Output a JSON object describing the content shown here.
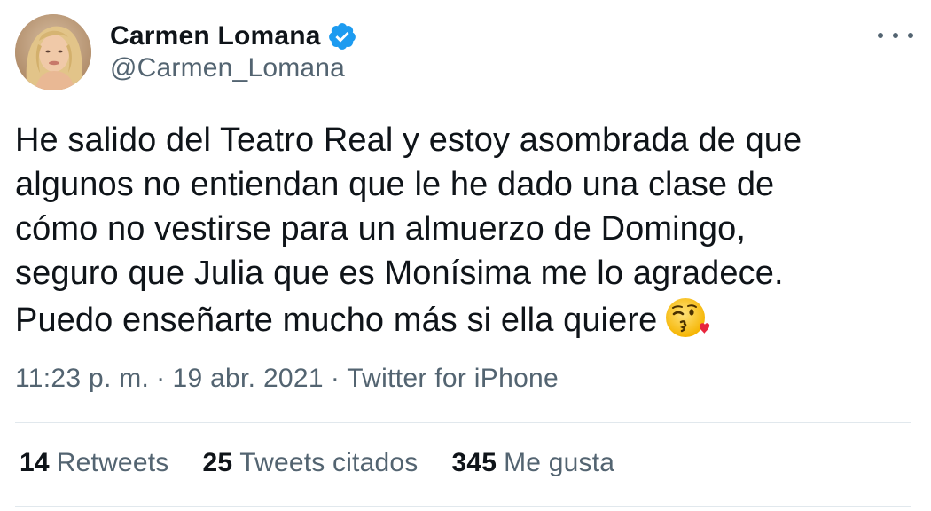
{
  "author": {
    "name": "Carmen Lomana",
    "handle": "@Carmen_Lomana",
    "verified_icon": "verified-badge-icon",
    "verified_color": "#1d9bf0"
  },
  "tweet": {
    "lines": [
      "He salido del Teatro Real y estoy asombrada de que",
      "algunos no entiendan que le he dado una clase de",
      "cómo no vestirse para un almuerzo de Domingo,",
      "seguro que Julia que es Monísima me lo agradece.",
      "Puedo enseñarte mucho más si ella quiere"
    ],
    "emoji_icon": "face-blowing-kiss-icon"
  },
  "meta": {
    "time": "11:23 p. m.",
    "separator": "·",
    "date": "19 abr. 2021",
    "source": "Twitter for iPhone"
  },
  "stats": {
    "retweets_count": "14",
    "retweets_label": "Retweets",
    "quotes_count": "25",
    "quotes_label": "Tweets citados",
    "likes_count": "345",
    "likes_label": "Me gusta"
  },
  "colors": {
    "text_primary": "#0f1419",
    "text_secondary": "#536471",
    "divider": "#e1e8ed"
  }
}
